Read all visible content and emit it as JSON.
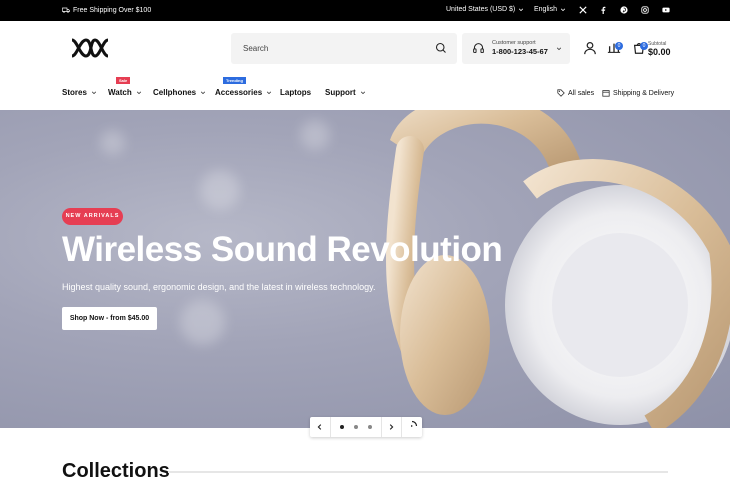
{
  "topbar": {
    "shipping_text": "Free Shipping Over $100",
    "currency": "United States (USD $)",
    "language": "English",
    "social_icons": [
      "x-icon",
      "facebook-icon",
      "pinterest-icon",
      "instagram-icon",
      "youtube-icon"
    ]
  },
  "header": {
    "search_placeholder": "Search",
    "support_label": "Customer support",
    "support_phone": "1-800-123-45-67",
    "compare_count": "0",
    "cart_count": "0",
    "subtotal_label": "Subtotal",
    "subtotal_value": "$0.00"
  },
  "nav": {
    "items": [
      {
        "label": "Stores"
      },
      {
        "label": "Watch",
        "tag": "Sale"
      },
      {
        "label": "Cellphones"
      },
      {
        "label": "Accessories",
        "tag": "Trending"
      },
      {
        "label": "Laptops"
      },
      {
        "label": "Support"
      }
    ],
    "right": [
      {
        "label": "All sales"
      },
      {
        "label": "Shipping & Delivery"
      }
    ]
  },
  "hero": {
    "badge": "NEW ARRIVALS",
    "title": "Wireless Sound Revolution",
    "subtitle": "Highest quality sound, ergonomic design, and the latest in wireless technology.",
    "cta": "Shop Now - from $45.00"
  },
  "collections_title": "Collections",
  "colors": {
    "accent": "#2d6cdf",
    "sale": "#e63e53",
    "trending": "#2d6cdf"
  }
}
